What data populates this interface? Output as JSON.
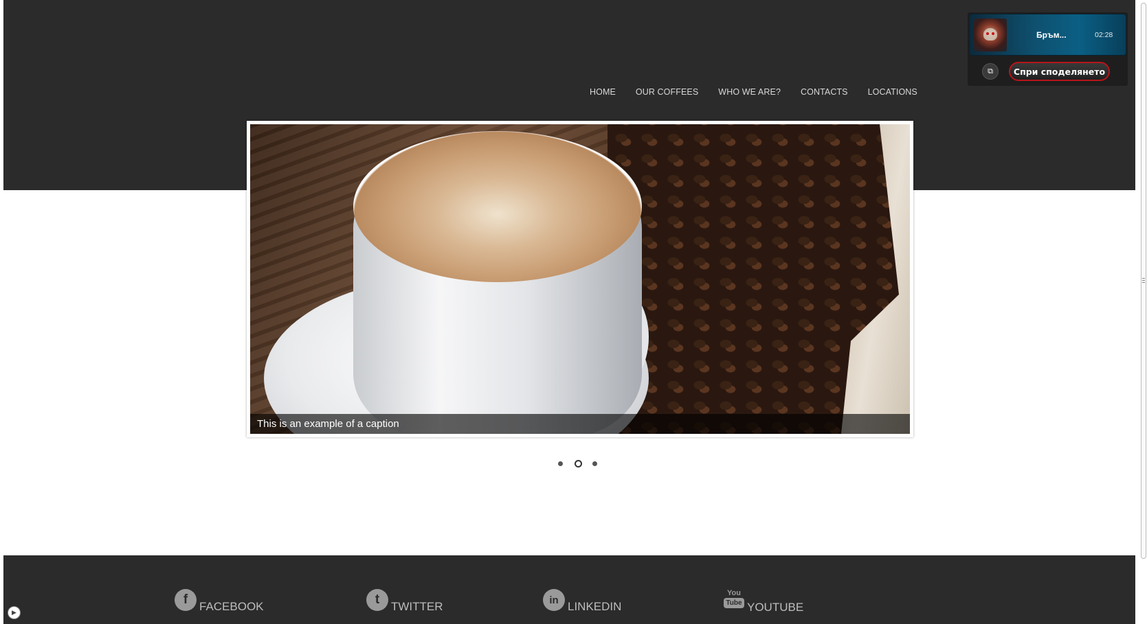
{
  "nav": {
    "items": [
      "HOME",
      "OUR COFFEES",
      "WHO WE ARE?",
      "CONTACTS",
      "LOCATIONS"
    ]
  },
  "share_widget": {
    "title": "Бръм...",
    "time": "02:28",
    "stop_label": "Спри споделянето",
    "popout_icon": "popout-icon"
  },
  "slider": {
    "caption": "This is an example of a caption",
    "slide_count": 3,
    "active_index": 1
  },
  "footer": {
    "social": [
      {
        "label": "FACEBOOK",
        "icon": "facebook-icon",
        "glyph": "f"
      },
      {
        "label": "TWITTER",
        "icon": "twitter-icon",
        "glyph": "t"
      },
      {
        "label": "LINKEDIN",
        "icon": "linkedin-icon",
        "glyph": "in"
      },
      {
        "label": "YOUTUBE",
        "icon": "youtube-icon",
        "glyph_top": "You",
        "glyph_bottom": "Tube"
      }
    ]
  },
  "colors": {
    "header_bg": "#2b2b2b",
    "footer_bg": "#2b2b2b",
    "stop_border": "#b8141a"
  }
}
